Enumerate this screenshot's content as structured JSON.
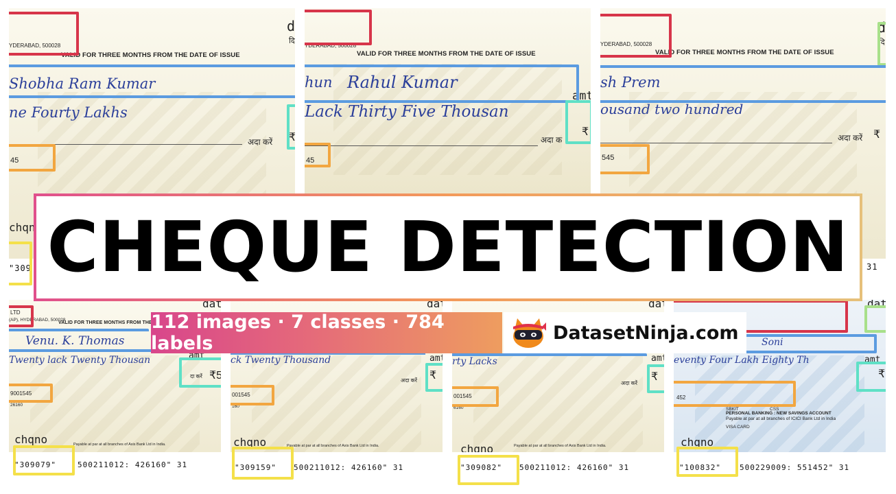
{
  "banner": {
    "title": "CHEQUE DETECTION",
    "stats": "112 images · 7 classes · 784 labels",
    "brand": "DatasetNinja.com"
  },
  "icons": {
    "logo": "ninja-cat-icon"
  },
  "colors": {
    "bank_name": "#d7354a",
    "payee": "#5b9be0",
    "amount_words": "#5b9be0",
    "amount": "#5fe0c6",
    "account_number": "#f2a640",
    "cheque_number": "#f4e04a",
    "date": "#a8e08a"
  },
  "top_cheques": [
    {
      "address": "YDERABAD, 500028",
      "valid": "VALID FOR THREE MONTHS FROM THE DATE OF ISSUE",
      "payee": "Shobha Ram Kumar",
      "words": "ne Fourty Lakhs",
      "pay": "अदा करें",
      "rupee": "₹",
      "account": "45",
      "chq_label": "chqno",
      "micr": "\"309",
      "date_label": "d",
      "date_hindi": "दि"
    },
    {
      "address": "YDERABAD, 500028",
      "valid": "VALID FOR THREE MONTHS FROM THE DATE OF ISSUE",
      "payee_prefix": "hun",
      "payee": "Rahul Kumar",
      "words": "Lack Thirty Five Thousan",
      "amt_label": "amt",
      "pay": "अदा क",
      "rupee": "₹",
      "account": "45"
    },
    {
      "address": "YDERABAD, 500028",
      "valid": "VALID FOR THREE MONTHS FROM THE DATE OF ISSUE",
      "payee": "sh Prem",
      "words": "ousand two hundred",
      "pay": "अदा करें",
      "rupee": "₹",
      "account": "545",
      "micr": "31",
      "date_label": "d",
      "date_hindi": "दि"
    }
  ],
  "bottom_cheques": [
    {
      "bank": "LTD",
      "address": "(AP), HYDERABAD, 500028",
      "valid": "VALID FOR THREE MONTHS FROM THE DATE OF ISSUE",
      "date_label": "dat",
      "payee": "Venu. K. Thomas",
      "words": "Twenty lack Twenty Thousan",
      "amt_label": "amt",
      "pay": "दा करें",
      "rupee": "₹5",
      "account": "9001545",
      "ifsc": "26160",
      "chq_label": "chqno",
      "payable": "Payable at par at all branches of Axis Bank Ltd in India.",
      "cheque_no": "\"309079\"",
      "micr": "500211012: 426160\" 31"
    },
    {
      "date_label": "dat",
      "words": "ck Twenty Thousand",
      "amt_label": "amt",
      "pay": "अदा करें",
      "rupee": "₹",
      "account": "001545",
      "ifsc": "160",
      "chq_label": "chqno",
      "payable": "Payable at par at all branches of Axis Bank Ltd in India.",
      "cheque_no": "\"309159\"",
      "micr": "500211012: 426160\" 31"
    },
    {
      "date_label": "dat",
      "words": "rty Lacks",
      "amt_label": "amt",
      "pay": "अदा करें",
      "rupee": "₹",
      "account": "001545",
      "ifsc": "6160",
      "chq_label": "chqno",
      "payable": "Payable at par at all branches of Axis Bank Ltd in India.",
      "cheque_no": "\"309082\"",
      "micr": "500211012: 426160\" 31"
    },
    {
      "date_label": "date",
      "payee": "Soni",
      "words": "eventy Four Lakh Eighty Th",
      "amt_label": "amt",
      "rupee": "₹",
      "account": "452",
      "sbkit": "SBKIT",
      "css": "CSS",
      "personal": "PERSONAL BANKING : NEW SAVINGS ACCOUNT",
      "icici": "Payable at par at all branches of ICICI Bank Ltd in India",
      "visa": "VISA CARD",
      "chq_label": "chqno",
      "cheque_no": "\"100832\"",
      "micr": "500229009: 551452\" 31"
    }
  ]
}
